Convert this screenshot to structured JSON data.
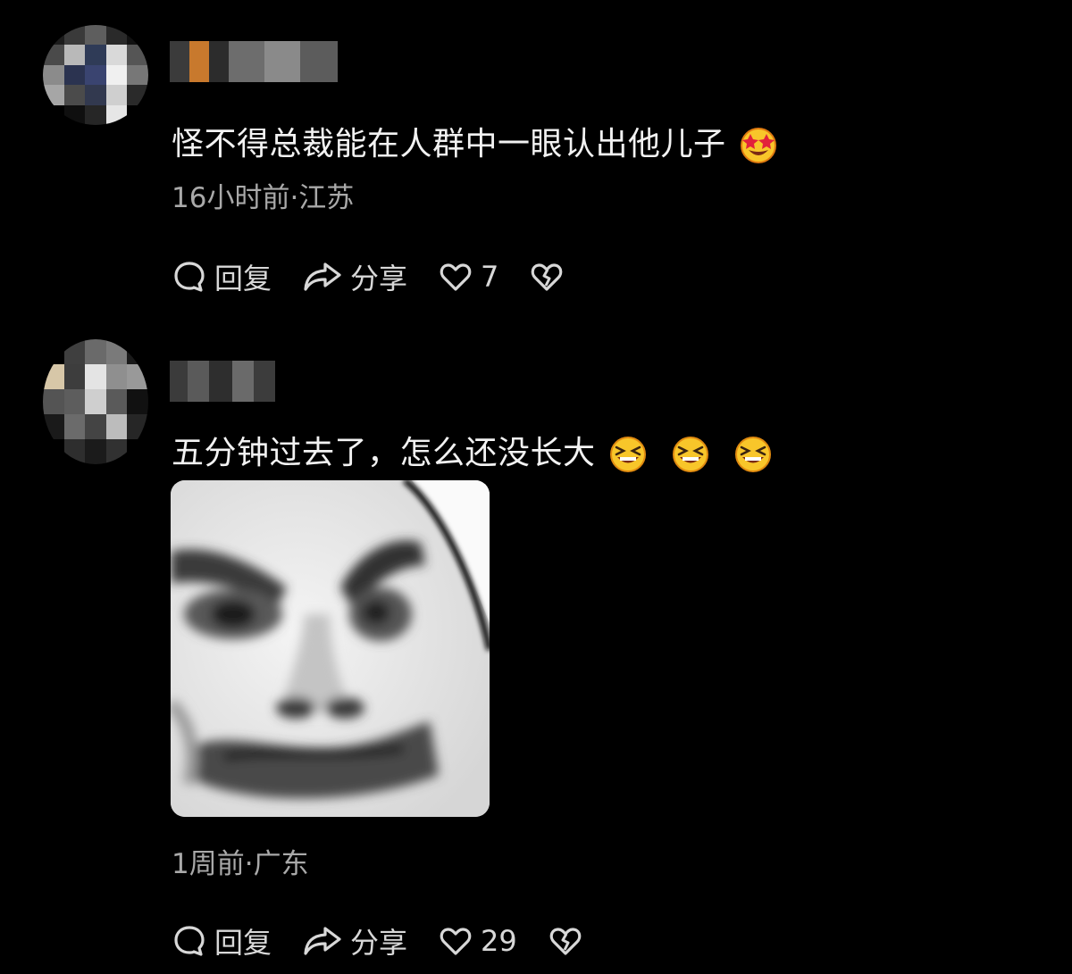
{
  "comments": [
    {
      "text": "怪不得总裁能在人群中一眼认出他儿子",
      "emoji": "star-struck-emoji",
      "meta": "16小时前·江苏",
      "actions": {
        "reply_label": "回复",
        "share_label": "分享",
        "like_count": "7"
      }
    },
    {
      "text": "五分钟过去了，怎么还没长大",
      "emoji": "grinning-squint-emoji",
      "emoji_count": 3,
      "meta": "1周前·广东",
      "actions": {
        "reply_label": "回复",
        "share_label": "分享",
        "like_count": "29"
      }
    }
  ],
  "icons": [
    "comment-bubble-icon",
    "share-arrow-icon",
    "heart-icon",
    "broken-heart-icon"
  ],
  "colors": {
    "background": "#000000",
    "text": "#f2f2f2",
    "meta": "#a9a9a9",
    "emoji_yellow": "#f8c62a"
  }
}
